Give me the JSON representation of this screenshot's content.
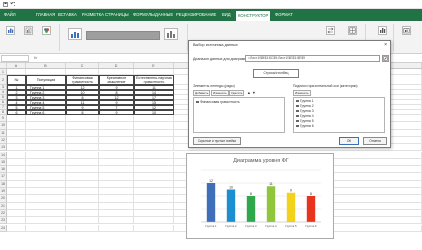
{
  "ribbon": {
    "tabs": [
      "ФАЙЛ",
      "ГЛАВНАЯ",
      "ВСТАВКА",
      "РАЗМЕТКА СТРАНИЦЫ",
      "ФОРМУЛЫ",
      "ДАННЫЕ",
      "РЕЦЕНЗИРОВАНИЕ",
      "ВИД",
      "КОНСТРУКТОР",
      "ФОРМАТ"
    ],
    "active_tab": "КОНСТРУКТОР",
    "accent": "#217346"
  },
  "table": {
    "column_letters": [
      "A",
      "B",
      "C",
      "D",
      "E",
      "F"
    ],
    "headers": [
      "№",
      "Популяция",
      "Финансовая грамотность",
      "Креативное мышление",
      "Естественно-научная грамотность"
    ],
    "rows": [
      [
        "1",
        "Группа 1",
        "12",
        "9",
        "11"
      ],
      [
        "2",
        "Группа 2",
        "10",
        "8",
        "14"
      ],
      [
        "3",
        "Группа 3",
        "8",
        "12",
        "17"
      ],
      [
        "4",
        "Группа 4",
        "11",
        "9",
        "15"
      ],
      [
        "5",
        "Группа 5",
        "9",
        "7",
        "12"
      ],
      [
        "6",
        "Группа 6",
        "8",
        "9",
        "10"
      ]
    ],
    "row_numbers": [
      "1",
      "2",
      "3",
      "4",
      "5",
      "6",
      "7",
      "8",
      "9",
      "10",
      "11",
      "12",
      "13",
      "14",
      "15",
      "16",
      "17",
      "18",
      "19",
      "20",
      "21",
      "22",
      "23",
      "24"
    ]
  },
  "dialog": {
    "title": "Выбор источника данных",
    "close": "×",
    "range_label": "Диапазон данных для диаграммы:",
    "range_value": "=Лист1!$B$3:$C$9;Лист1!$E$3:$E$9",
    "switch_label": "Строка/столбец",
    "legend_panel_title": "Элементы легенды (ряды)",
    "axis_panel_title": "Подписи горизонтальной оси (категории)",
    "add_label": "Добавить",
    "edit_label": "Изменить",
    "delete_label": "Удалить",
    "axis_edit_label": "Изменить",
    "legend_items": [
      "Финансовая грамотность"
    ],
    "axis_items": [
      "Группа 1",
      "Группа 2",
      "Группа 3",
      "Группа 4",
      "Группа 5",
      "Группа 6"
    ],
    "hidden_cells_label": "Скрытые и пустые ячейки",
    "ok_label": "ОК",
    "cancel_label": "Отмена"
  },
  "chart_data": {
    "type": "bar",
    "title": "Диаграмма уровня ФГ",
    "categories": [
      "Группа 1",
      "Группа 2",
      "Группа 3",
      "Группа 4",
      "Группа 5",
      "Группа 6"
    ],
    "values": [
      12,
      10,
      8,
      11,
      9,
      8
    ],
    "ylim": [
      0,
      16
    ],
    "colors": [
      "#3f6fb8",
      "#1d8fd0",
      "#2ea84a",
      "#8fc63c",
      "#f2d21b",
      "#e8341c"
    ],
    "xlabel": "",
    "ylabel": ""
  }
}
